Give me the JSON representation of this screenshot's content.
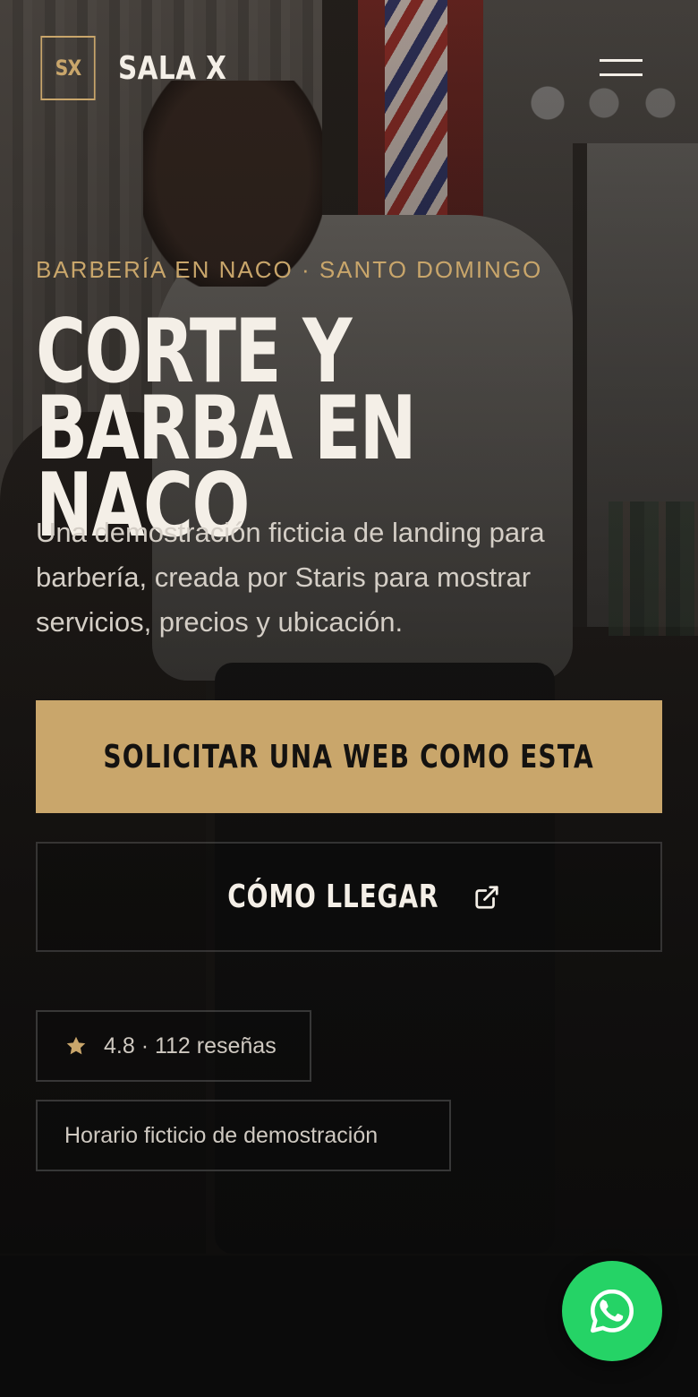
{
  "brand": {
    "monogram": "SX",
    "name": "SALA X",
    "accent_color": "#c9a66b"
  },
  "header": {
    "menu_icon": "hamburger-menu-icon"
  },
  "hero": {
    "kicker": "BARBERÍA EN NACO · SANTO DOMINGO",
    "title": "CORTE Y BARBA EN NACO",
    "lead": "Una demostración ficticia de landing para barbería, creada por Staris para mostrar servicios, precios y ubicación.",
    "primary_button": "SOLICITAR UNA WEB COMO ESTA",
    "secondary_button": "CÓMO LLEGAR",
    "secondary_button_icon": "external-link-icon",
    "background_image": "barber-cutting-hair-photo"
  },
  "badges": {
    "rating": {
      "icon": "star-icon",
      "text": "4.8 · 112 reseñas"
    },
    "hours": {
      "text": "Horario ficticio de demostración"
    }
  },
  "floating": {
    "whatsapp_icon": "whatsapp-icon",
    "whatsapp_color": "#25d366"
  }
}
